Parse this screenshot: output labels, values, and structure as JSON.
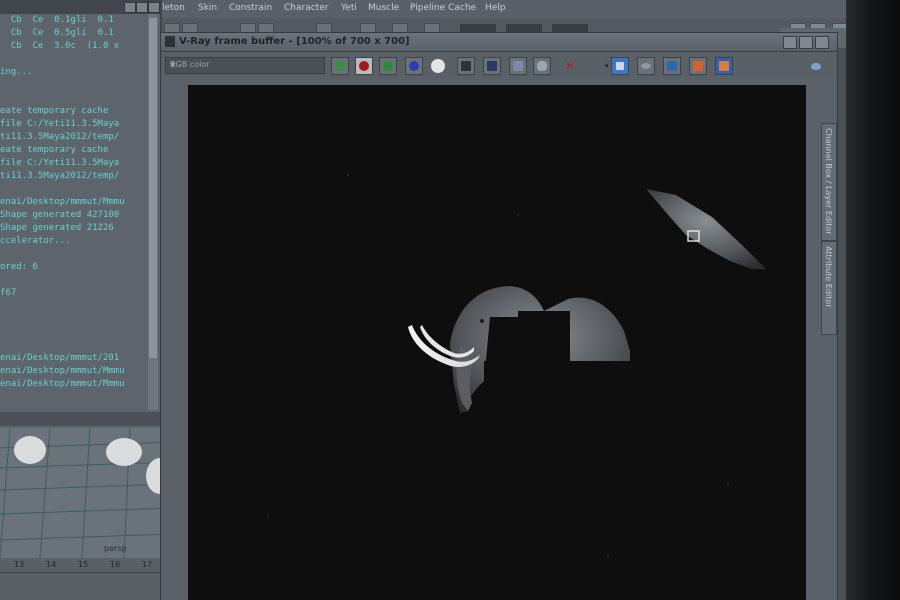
{
  "menubar": {
    "items": [
      "leton",
      "Skin",
      "Constrain",
      "Character",
      "Yeti",
      "Muscle",
      "Pipeline Cache",
      "Help"
    ]
  },
  "script_editor": {
    "lines": [
      "  Cb  Ce  0.1gli  0.1",
      "  Cb  Ce  0.5gli  0.1",
      "  Cb  Ce  3.0c  (1.0 x",
      "",
      "ing...",
      "",
      "",
      "eate temporary cache",
      "file C:/Yeti11.3.5Maya",
      "ti11.3.5Maya2012/temp/",
      "eate temporary cache",
      "file C:/Yeti11.3.5Maya",
      "ti11.3.5Maya2012/temp/",
      "",
      "enai/Desktop/mmmut/Mmmu",
      "Shape generated 427100",
      "Shape generated 21226",
      "ccelerator...",
      "",
      "ored: 6",
      "",
      "f67",
      "",
      "",
      "",
      "",
      "enai/Desktop/mmmut/201",
      "enai/Desktop/mmmut/Mmmu",
      "enai/Desktop/mmmut/Mmmu"
    ]
  },
  "viewport": {
    "label": "persp"
  },
  "timeline": {
    "ticks": [
      "13",
      "14",
      "15",
      "16",
      "17"
    ]
  },
  "vfb": {
    "title": "V-Ray frame buffer - [100% of 700 x 700]",
    "channel": "RGB color",
    "toolbar_icons": [
      "rgb-channels-icon",
      "red-channel-icon",
      "green-channel-icon",
      "blue-channel-icon",
      "alpha-channel-icon",
      "monochrome-icon",
      "save-image-icon",
      "load-image-icon",
      "clear-image-icon",
      "close-x-icon",
      "track-mouse-icon",
      "region-render-icon",
      "link-to-3d-icon",
      "render-icon",
      "stop-render-icon",
      "lens-effects-icon"
    ]
  },
  "side_tabs": [
    "Channel Box / Layer Editor",
    "Attribute Editor"
  ],
  "colors": {
    "script_text": "#67d2cf",
    "render_bg": "#0e0e0e",
    "ui_bg": "#5b6168"
  }
}
